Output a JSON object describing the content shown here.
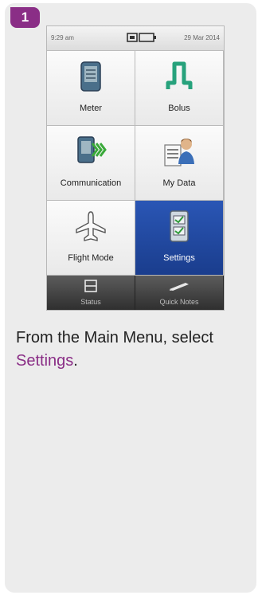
{
  "step": {
    "number": "1"
  },
  "device": {
    "status_bar": {
      "time": "9:29 am",
      "date": "29 Mar 2014"
    },
    "menu_items": [
      {
        "label": "Meter",
        "icon": "meter-icon"
      },
      {
        "label": "Bolus",
        "icon": "bolus-icon"
      },
      {
        "label": "Communication",
        "icon": "communication-icon"
      },
      {
        "label": "My Data",
        "icon": "my-data-icon"
      },
      {
        "label": "Flight Mode",
        "icon": "airplane-icon"
      },
      {
        "label": "Settings",
        "icon": "settings-checklist-icon",
        "selected": true
      }
    ],
    "bottom_bar": [
      {
        "label": "Status",
        "icon": "status-icon"
      },
      {
        "label": "Quick Notes",
        "icon": "quick-notes-icon"
      }
    ]
  },
  "instruction": {
    "text_before": "From the Main Menu, select ",
    "highlight": "Settings",
    "text_after": "."
  },
  "colors": {
    "accent": "#8a2e86",
    "selected_tile": "#1f47a0"
  }
}
